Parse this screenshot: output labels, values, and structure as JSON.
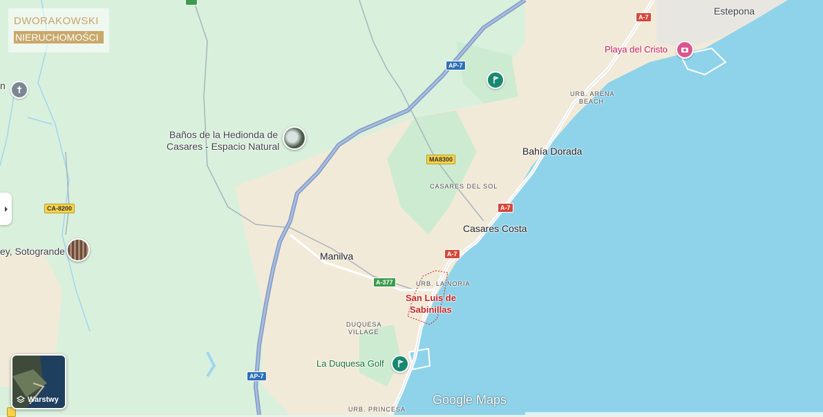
{
  "logo": {
    "line1": "DWORAKOWSKI",
    "line2": "NIERUCHOMOŚCI"
  },
  "places": {
    "estepona": "Estepona",
    "playa": "Playa del Cristo",
    "urb_arena_1": "URB. ARENA",
    "urb_arena_2": "BEACH",
    "banos_1": "Baños de la Hedionda de",
    "banos_2": "Casares - Espacio Natural",
    "bahia": "Bahía Dorada",
    "casares_sol": "CASARES DEL SOL",
    "casares_costa": "Casares Costa",
    "manilva": "Manilva",
    "urb_noria": "URB. LA NORIA",
    "san_luis_1": "San Luis de",
    "san_luis_2": "Sabinillas",
    "duquesa_1": "DUQUESA",
    "duquesa_2": "VILLAGE",
    "duquesa_golf": "La Duquesa Golf",
    "urb_princesa": "URB. PRINCESA",
    "sotogrande": "ey, Sotogrande",
    "left_n": "n"
  },
  "roads": {
    "ap7_top": "AP-7",
    "ap7_bottom": "AP-7",
    "a7_top": "A-7",
    "a7_mid": "A-7",
    "a7_low": "A-7",
    "ma8300": "MA8300",
    "ca8200": "CA-8200",
    "a377": "A-377"
  },
  "controls": {
    "layers_label": "Warstwy",
    "google_maps": "Google Maps"
  },
  "colors": {
    "water": "#8fd3ea",
    "land_green": "#d9f0dc",
    "land_beige": "#f2ead8",
    "road_major": "#8fa6c9",
    "road_minor": "#ffffff"
  }
}
